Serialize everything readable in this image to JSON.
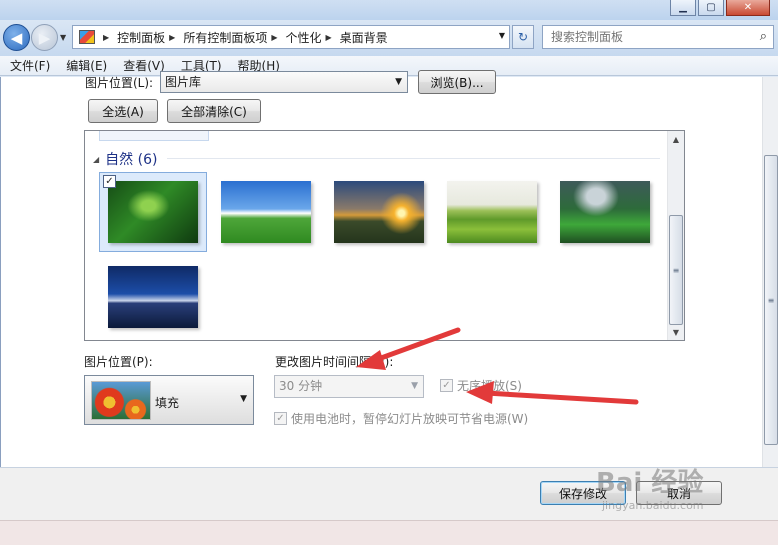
{
  "address": {
    "crumbs": [
      "控制面板",
      "所有控制面板项",
      "个性化",
      "桌面背景"
    ]
  },
  "search": {
    "placeholder": "搜索控制面板"
  },
  "menu": {
    "items": [
      "文件(F)",
      "编辑(E)",
      "查看(V)",
      "工具(T)",
      "帮助(H)"
    ]
  },
  "picture_location": {
    "label": "图片位置(L):",
    "value": "图片库",
    "browse_label": "浏览(B)..."
  },
  "selection_buttons": {
    "select_all": "全选(A)",
    "clear_all": "全部清除(C)"
  },
  "gallery": {
    "group_title": "自然 (6)",
    "selected_index": 0,
    "thumbnails": [
      {
        "name": "forest",
        "checked": true,
        "check_glyph": "✓"
      },
      {
        "name": "sky-field",
        "checked": false
      },
      {
        "name": "sunset",
        "checked": false
      },
      {
        "name": "green-field",
        "checked": false
      },
      {
        "name": "green-hills",
        "checked": false
      },
      {
        "name": "bridge",
        "checked": false
      }
    ]
  },
  "position": {
    "label": "图片位置(P):",
    "value": "填充"
  },
  "interval": {
    "label": "更改图片时间间隔(N):",
    "value": "30 分钟"
  },
  "shuffle": {
    "label": "无序播放(S)",
    "checked": true,
    "check_glyph": "✓"
  },
  "battery": {
    "label": "使用电池时，暂停幻灯片放映可节省电源(W)",
    "checked": true,
    "check_glyph": "✓"
  },
  "footer": {
    "save_label": "保存修改",
    "cancel_label": "取消"
  },
  "watermark": {
    "logo": "Bai 经验",
    "url": "jingyan.baidu.com"
  },
  "colors": {
    "annotation_arrow": "#e23a3a",
    "group_title": "#1e3287",
    "selection": "#dceafb"
  }
}
